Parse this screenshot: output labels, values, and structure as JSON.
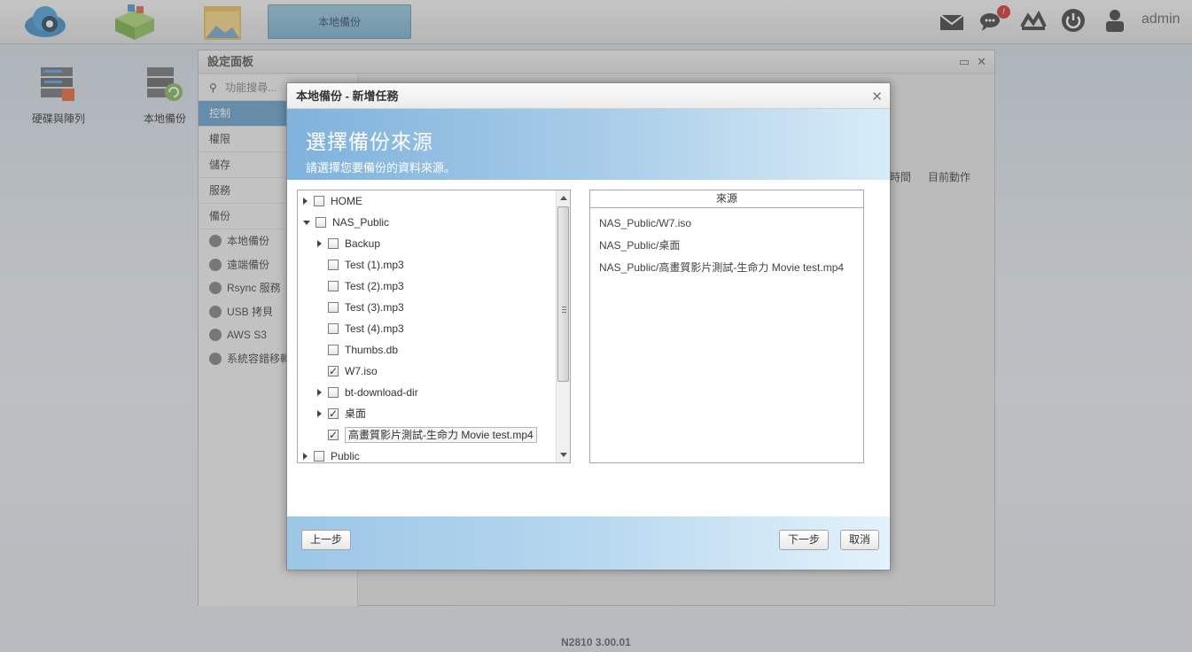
{
  "topbar": {
    "active_task": "本地備份",
    "user": "admin",
    "notification_count": "!"
  },
  "desktop": {
    "icons": [
      {
        "label": "硬碟與陣列"
      },
      {
        "label": "本地備份"
      }
    ]
  },
  "settings": {
    "title": "設定面板",
    "search_placeholder": "功能搜尋...",
    "nav": [
      "控制",
      "權限",
      "儲存",
      "服務",
      "備份"
    ],
    "sub_nav": [
      "本地備份",
      "遠端備份",
      "Rsync 服務",
      "USB 拷貝",
      "AWS S3",
      "系統容錯移轉"
    ],
    "columns": [
      "時間",
      "目前動作"
    ]
  },
  "dialog": {
    "title": "本地備份 - 新增任務",
    "heading": "選擇備份來源",
    "subheading": "請選擇您要備份的資料來源。",
    "tree": [
      {
        "label": "HOME",
        "level": 0,
        "expander": "collapsed",
        "checked": false
      },
      {
        "label": "NAS_Public",
        "level": 0,
        "expander": "expanded",
        "checked": false
      },
      {
        "label": "Backup",
        "level": 1,
        "expander": "collapsed",
        "checked": false
      },
      {
        "label": "Test (1).mp3",
        "level": 1,
        "expander": "none",
        "checked": false
      },
      {
        "label": "Test (2).mp3",
        "level": 1,
        "expander": "none",
        "checked": false
      },
      {
        "label": "Test (3).mp3",
        "level": 1,
        "expander": "none",
        "checked": false
      },
      {
        "label": "Test (4).mp3",
        "level": 1,
        "expander": "none",
        "checked": false
      },
      {
        "label": "Thumbs.db",
        "level": 1,
        "expander": "none",
        "checked": false
      },
      {
        "label": "W7.iso",
        "level": 1,
        "expander": "none",
        "checked": true
      },
      {
        "label": "bt-download-dir",
        "level": 1,
        "expander": "collapsed",
        "checked": false
      },
      {
        "label": "桌面",
        "level": 1,
        "expander": "collapsed",
        "checked": true
      },
      {
        "label": "高畫質影片測試-生命力 Movie test.mp4",
        "level": 1,
        "expander": "none",
        "checked": true,
        "selected": true
      },
      {
        "label": "Public",
        "level": 0,
        "expander": "collapsed",
        "checked": false
      }
    ],
    "source_header": "來源",
    "sources": [
      "NAS_Public/W7.iso",
      "NAS_Public/桌面",
      "NAS_Public/高畫質影片測試-生命力 Movie test.mp4"
    ],
    "buttons": {
      "prev": "上一步",
      "next": "下一步",
      "cancel": "取消"
    }
  },
  "footer": {
    "version": "N2810   3.00.01"
  }
}
